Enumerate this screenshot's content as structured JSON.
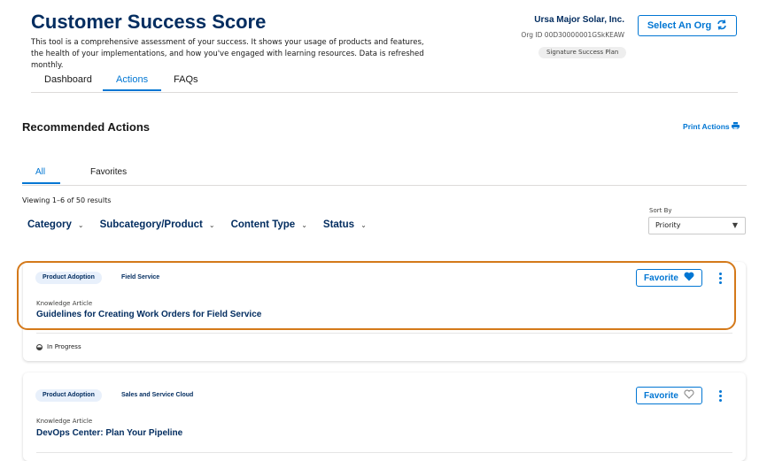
{
  "header": {
    "title": "Customer Success Score",
    "description": "This tool is a comprehensive assessment of your success. It shows your usage of products and features, the health of your implementations, and how you've engaged with learning resources. Data is refreshed monthly.",
    "org_name": "Ursa Major Solar, Inc.",
    "org_id": "Org ID 00D30000001GSkKEAW",
    "plan_badge": "Signature Success Plan",
    "select_org_label": "Select An Org",
    "select_org_icon": "sync-icon"
  },
  "main_tabs": [
    {
      "label": "Dashboard",
      "active": false
    },
    {
      "label": "Actions",
      "active": true
    },
    {
      "label": "FAQs",
      "active": false
    }
  ],
  "section": {
    "title": "Recommended Actions",
    "print_label": "Print Actions",
    "print_icon": "printer-icon"
  },
  "sub_tabs": [
    {
      "label": "All",
      "active": true
    },
    {
      "label": "Favorites",
      "active": false
    }
  ],
  "results_text": "Viewing 1–6 of 50 results",
  "filters": [
    {
      "label": "Category"
    },
    {
      "label": "Subcategory/Product"
    },
    {
      "label": "Content Type"
    },
    {
      "label": "Status"
    }
  ],
  "sort": {
    "label": "Sort By",
    "selected": "Priority"
  },
  "cards": [
    {
      "tags": [
        "Product Adoption",
        "Field Service"
      ],
      "kind": "Knowledge Article",
      "title": "Guidelines for Creating Work Orders for Field Service",
      "favorite_label": "Favorite",
      "favorited": true,
      "status": "In Progress",
      "highlighted": true
    },
    {
      "tags": [
        "Product Adoption",
        "Sales and Service Cloud"
      ],
      "kind": "Knowledge Article",
      "title": "DevOps Center: Plan Your Pipeline",
      "favorite_label": "Favorite",
      "favorited": false
    }
  ],
  "colors": {
    "brand_blue": "#0176d3",
    "navy": "#032d60",
    "highlight": "#d4791a"
  }
}
